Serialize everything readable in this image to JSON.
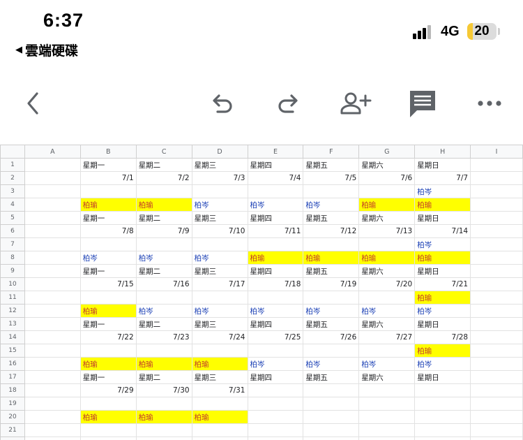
{
  "status": {
    "time": "6:37",
    "back_app": "雲端硬碟",
    "network": "4G",
    "battery": "20",
    "battery_level": 0.2
  },
  "toolbar": {
    "buttons": [
      {
        "name": "back-icon"
      },
      {
        "name": "undo-icon"
      },
      {
        "name": "redo-icon"
      },
      {
        "name": "add-person-icon"
      },
      {
        "name": "comment-icon"
      },
      {
        "name": "more-icon"
      }
    ]
  },
  "colors": {
    "highlight": "#ffff00",
    "name_red": "#c0392b",
    "name_blue": "#1a3fb5"
  },
  "sheet": {
    "columns": [
      "A",
      "B",
      "C",
      "D",
      "E",
      "F",
      "G",
      "H",
      "I"
    ],
    "rows": [
      {
        "n": "1",
        "cells": [
          [
            "",
            ""
          ],
          [
            "星期一",
            "c"
          ],
          [
            "星期二",
            "c"
          ],
          [
            "星期三",
            "c"
          ],
          [
            "星期四",
            "c"
          ],
          [
            "星期五",
            "c"
          ],
          [
            "星期六",
            "c"
          ],
          [
            "星期日",
            "c"
          ],
          [
            "",
            ""
          ]
        ]
      },
      {
        "n": "2",
        "cells": [
          [
            "",
            ""
          ],
          [
            "7/1",
            "r"
          ],
          [
            "7/2",
            "r"
          ],
          [
            "7/3",
            "r"
          ],
          [
            "7/4",
            "r"
          ],
          [
            "7/5",
            "r"
          ],
          [
            "7/6",
            "r"
          ],
          [
            "7/7",
            "r"
          ],
          [
            "",
            ""
          ]
        ]
      },
      {
        "n": "3",
        "cells": [
          [
            "",
            ""
          ],
          [
            "",
            ""
          ],
          [
            "",
            ""
          ],
          [
            "",
            ""
          ],
          [
            "",
            ""
          ],
          [
            "",
            ""
          ],
          [
            "",
            ""
          ],
          [
            "柏岑",
            "b"
          ],
          [
            "",
            ""
          ]
        ]
      },
      {
        "n": "4",
        "cells": [
          [
            "",
            ""
          ],
          [
            "柏瑜",
            "y"
          ],
          [
            "柏瑜",
            "y"
          ],
          [
            "柏岑",
            "b"
          ],
          [
            "柏岑",
            "b"
          ],
          [
            "柏岑",
            "b"
          ],
          [
            "柏瑜",
            "y"
          ],
          [
            "柏瑜",
            "y"
          ],
          [
            "",
            ""
          ]
        ]
      },
      {
        "n": "5",
        "cells": [
          [
            "",
            ""
          ],
          [
            "星期一",
            "c"
          ],
          [
            "星期二",
            "c"
          ],
          [
            "星期三",
            "c"
          ],
          [
            "星期四",
            "c"
          ],
          [
            "星期五",
            "c"
          ],
          [
            "星期六",
            "c"
          ],
          [
            "星期日",
            "c"
          ],
          [
            "",
            ""
          ]
        ]
      },
      {
        "n": "6",
        "cells": [
          [
            "",
            ""
          ],
          [
            "7/8",
            "r"
          ],
          [
            "7/9",
            "r"
          ],
          [
            "7/10",
            "r"
          ],
          [
            "7/11",
            "r"
          ],
          [
            "7/12",
            "r"
          ],
          [
            "7/13",
            "r"
          ],
          [
            "7/14",
            "r"
          ],
          [
            "",
            ""
          ]
        ]
      },
      {
        "n": "7",
        "cells": [
          [
            "",
            ""
          ],
          [
            "",
            ""
          ],
          [
            "",
            ""
          ],
          [
            "",
            ""
          ],
          [
            "",
            ""
          ],
          [
            "",
            ""
          ],
          [
            "",
            ""
          ],
          [
            "柏岑",
            "b"
          ],
          [
            "",
            ""
          ]
        ]
      },
      {
        "n": "8",
        "cells": [
          [
            "",
            ""
          ],
          [
            "柏岑",
            "b"
          ],
          [
            "柏岑",
            "b"
          ],
          [
            "柏岑",
            "b"
          ],
          [
            "柏瑜",
            "y"
          ],
          [
            "柏瑜",
            "y"
          ],
          [
            "柏瑜",
            "y"
          ],
          [
            "柏瑜",
            "y"
          ],
          [
            "",
            ""
          ]
        ]
      },
      {
        "n": "9",
        "cells": [
          [
            "",
            ""
          ],
          [
            "星期一",
            "c"
          ],
          [
            "星期二",
            "c"
          ],
          [
            "星期三",
            "c"
          ],
          [
            "星期四",
            "c"
          ],
          [
            "星期五",
            "c"
          ],
          [
            "星期六",
            "c"
          ],
          [
            "星期日",
            "c"
          ],
          [
            "",
            ""
          ]
        ]
      },
      {
        "n": "10",
        "cells": [
          [
            "",
            ""
          ],
          [
            "7/15",
            "r"
          ],
          [
            "7/16",
            "r"
          ],
          [
            "7/17",
            "r"
          ],
          [
            "7/18",
            "r"
          ],
          [
            "7/19",
            "r"
          ],
          [
            "7/20",
            "r"
          ],
          [
            "7/21",
            "r"
          ],
          [
            "",
            ""
          ]
        ]
      },
      {
        "n": "11",
        "cells": [
          [
            "",
            ""
          ],
          [
            "",
            ""
          ],
          [
            "",
            ""
          ],
          [
            "",
            ""
          ],
          [
            "",
            ""
          ],
          [
            "",
            ""
          ],
          [
            "",
            ""
          ],
          [
            "柏瑜",
            "y"
          ],
          [
            "",
            ""
          ]
        ]
      },
      {
        "n": "12",
        "cells": [
          [
            "",
            ""
          ],
          [
            "柏瑜",
            "y"
          ],
          [
            "柏岑",
            "b"
          ],
          [
            "柏岑",
            "b"
          ],
          [
            "柏岑",
            "b"
          ],
          [
            "柏岑",
            "b"
          ],
          [
            "柏岑",
            "b"
          ],
          [
            "柏岑",
            "b"
          ],
          [
            "",
            ""
          ]
        ]
      },
      {
        "n": "13",
        "cells": [
          [
            "",
            ""
          ],
          [
            "星期一",
            "c"
          ],
          [
            "星期二",
            "c"
          ],
          [
            "星期三",
            "c"
          ],
          [
            "星期四",
            "c"
          ],
          [
            "星期五",
            "c"
          ],
          [
            "星期六",
            "c"
          ],
          [
            "星期日",
            "c"
          ],
          [
            "",
            ""
          ]
        ]
      },
      {
        "n": "14",
        "cells": [
          [
            "",
            ""
          ],
          [
            "7/22",
            "r"
          ],
          [
            "7/23",
            "r"
          ],
          [
            "7/24",
            "r"
          ],
          [
            "7/25",
            "r"
          ],
          [
            "7/26",
            "r"
          ],
          [
            "7/27",
            "r"
          ],
          [
            "7/28",
            "r"
          ],
          [
            "",
            ""
          ]
        ]
      },
      {
        "n": "15",
        "cells": [
          [
            "",
            ""
          ],
          [
            "",
            ""
          ],
          [
            "",
            ""
          ],
          [
            "",
            ""
          ],
          [
            "",
            ""
          ],
          [
            "",
            ""
          ],
          [
            "",
            ""
          ],
          [
            "柏瑜",
            "y"
          ],
          [
            "",
            ""
          ]
        ]
      },
      {
        "n": "16",
        "cells": [
          [
            "",
            ""
          ],
          [
            "柏瑜",
            "y"
          ],
          [
            "柏瑜",
            "y"
          ],
          [
            "柏瑜",
            "y"
          ],
          [
            "柏岑",
            "b"
          ],
          [
            "柏岑",
            "b"
          ],
          [
            "柏岑",
            "b"
          ],
          [
            "柏岑",
            "b"
          ],
          [
            "",
            ""
          ]
        ]
      },
      {
        "n": "17",
        "cells": [
          [
            "",
            ""
          ],
          [
            "星期一",
            "c"
          ],
          [
            "星期二",
            "c"
          ],
          [
            "星期三",
            "c"
          ],
          [
            "星期四",
            "c"
          ],
          [
            "星期五",
            "c"
          ],
          [
            "星期六",
            "c"
          ],
          [
            "星期日",
            "c"
          ],
          [
            "",
            ""
          ]
        ]
      },
      {
        "n": "18",
        "cells": [
          [
            "",
            ""
          ],
          [
            "7/29",
            "r"
          ],
          [
            "7/30",
            "r"
          ],
          [
            "7/31",
            "r"
          ],
          [
            "",
            ""
          ],
          [
            "",
            ""
          ],
          [
            "",
            ""
          ],
          [
            "",
            ""
          ],
          [
            "",
            ""
          ]
        ]
      },
      {
        "n": "19",
        "cells": [
          [
            "",
            ""
          ],
          [
            "",
            ""
          ],
          [
            "",
            ""
          ],
          [
            "",
            ""
          ],
          [
            "",
            ""
          ],
          [
            "",
            ""
          ],
          [
            "",
            ""
          ],
          [
            "",
            ""
          ],
          [
            "",
            ""
          ]
        ]
      },
      {
        "n": "20",
        "cells": [
          [
            "",
            ""
          ],
          [
            "柏瑜",
            "y"
          ],
          [
            "柏瑜",
            "y"
          ],
          [
            "柏瑜",
            "y"
          ],
          [
            "",
            ""
          ],
          [
            "",
            ""
          ],
          [
            "",
            ""
          ],
          [
            "",
            ""
          ],
          [
            "",
            ""
          ]
        ]
      },
      {
        "n": "21",
        "cells": [
          [
            "",
            ""
          ],
          [
            "",
            ""
          ],
          [
            "",
            ""
          ],
          [
            "",
            ""
          ],
          [
            "",
            ""
          ],
          [
            "",
            ""
          ],
          [
            "",
            ""
          ],
          [
            "",
            ""
          ],
          [
            "",
            ""
          ]
        ]
      },
      {
        "n": "22",
        "cells": [
          [
            "",
            ""
          ],
          [
            "",
            ""
          ],
          [
            "",
            ""
          ],
          [
            "",
            ""
          ],
          [
            "",
            ""
          ],
          [
            "",
            ""
          ],
          [
            "",
            ""
          ],
          [
            "",
            ""
          ],
          [
            "",
            ""
          ]
        ]
      }
    ]
  }
}
